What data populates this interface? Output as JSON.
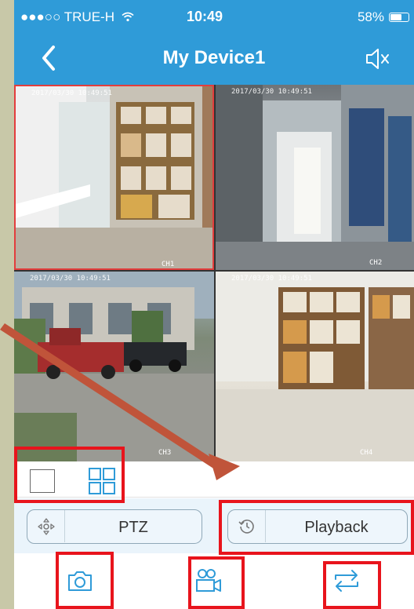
{
  "status_bar": {
    "carrier": "●●●○○ TRUE-H",
    "time": "10:49",
    "battery": "58%",
    "battery_level": 0.58,
    "wifi_icon": "wifi-icon"
  },
  "nav": {
    "title": "My Device1",
    "back_icon": "chevron-left-icon",
    "mute_icon": "speaker-muted-icon"
  },
  "cameras": [
    {
      "timestamp": "2017/03/30 10:49:51",
      "channel": "CH1",
      "selected": true
    },
    {
      "timestamp": "2017/03/30 10:49:51",
      "channel": "CH2",
      "selected": false
    },
    {
      "timestamp": "2017/03/30 10:49:51",
      "channel": "CH3",
      "selected": false
    },
    {
      "timestamp": "2017/03/30 10:49:51",
      "channel": "CH4",
      "selected": false
    }
  ],
  "layout_options": {
    "single_icon": "single-view-icon",
    "quad_icon": "quad-view-icon",
    "active": "quad"
  },
  "controls": {
    "ptz_label": "PTZ",
    "playback_label": "Playback"
  },
  "actions": {
    "snapshot_icon": "camera-icon",
    "record_icon": "video-record-icon",
    "switch_icon": "switch-stream-icon"
  },
  "colors": {
    "header_bg": "#2f9bd8",
    "accent": "#2f9bd8",
    "highlight": "#e8141c",
    "arrow": "#c0543a"
  }
}
